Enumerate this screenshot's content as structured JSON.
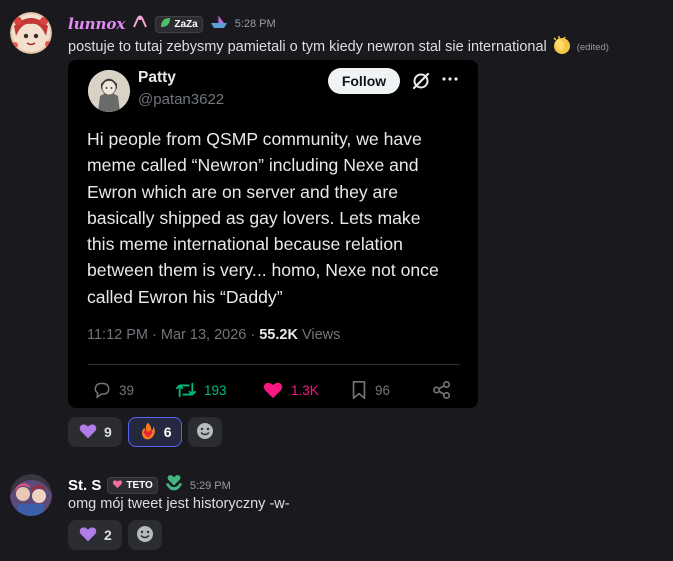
{
  "messages": [
    {
      "username": "lunnox",
      "username_color": "#e48cf5",
      "tag": "ZaZa",
      "timestamp": "5:28 PM",
      "text": "postuje to tutaj zebysmy pamietali o tym kiedy newron stal sie international",
      "edited": "(edited)",
      "reactions": [
        {
          "icon": "purple-heart",
          "count": "9",
          "active": false
        },
        {
          "icon": "fire-heart",
          "count": "6",
          "active": true
        }
      ]
    },
    {
      "username": "St. S",
      "username_color": "#ffffff",
      "tag": "TETO",
      "timestamp": "5:29 PM",
      "text": "omg mój tweet jest historyczny -w-",
      "reactions": [
        {
          "icon": "purple-heart",
          "count": "2",
          "active": false
        }
      ]
    }
  ],
  "embed": {
    "name": "Patty",
    "handle": "@patan3622",
    "follow_label": "Follow",
    "tweet_text": "Hi people from QSMP community, we have\nmeme called “Newron” including Nexe and\nEwron which are on server and they are\nbasically shipped as gay lovers. Lets make\nthis meme international because relation\nbetween them is very... homo, Nexe not once\ncalled Ewron his “Daddy”",
    "time": "11:12 PM",
    "date": "Mar 13, 2026",
    "views_count": "55.2K",
    "views_label": "Views",
    "replies": "39",
    "reposts": "193",
    "likes": "1.3K",
    "bookmarks": "96",
    "colors": {
      "repost": "#00ba7c",
      "like": "#f91880",
      "muted": "#71767b"
    }
  }
}
